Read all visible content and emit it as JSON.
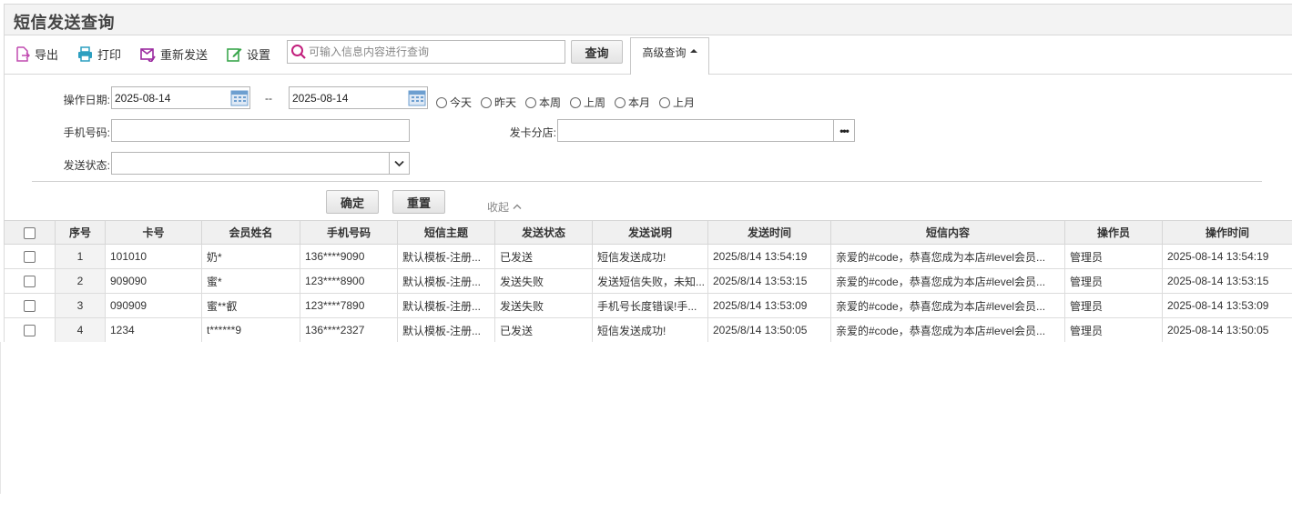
{
  "page": {
    "title": "短信发送查询"
  },
  "toolbar": {
    "export_label": "导出",
    "print_label": "打印",
    "resend_label": "重新发送",
    "settings_label": "设置",
    "search_placeholder": "可输入信息内容进行查询",
    "search_button": "查询",
    "advanced_tab": "高级查询"
  },
  "filters": {
    "date_label": "操作日期:",
    "date_from": "2025-08-14",
    "date_sep": "--",
    "date_to": "2025-08-14",
    "quick_ranges": [
      "今天",
      "昨天",
      "本周",
      "上周",
      "本月",
      "上月"
    ],
    "phone_label": "手机号码:",
    "phone_value": "",
    "branch_label": "发卡分店:",
    "branch_value": "",
    "status_label": "发送状态:",
    "status_value": "",
    "confirm_button": "确定",
    "reset_button": "重置",
    "collapse_label": "收起"
  },
  "table": {
    "columns": [
      "序号",
      "卡号",
      "会员姓名",
      "手机号码",
      "短信主题",
      "发送状态",
      "发送说明",
      "发送时间",
      "短信内容",
      "操作员",
      "操作时间"
    ],
    "rows": [
      [
        "1",
        "101010",
        "奶*",
        "136****9090",
        "默认模板-注册...",
        "已发送",
        "短信发送成功!",
        "2025/8/14 13:54:19",
        "亲爱的#code，恭喜您成为本店#level会员...",
        "管理员",
        "2025-08-14 13:54:19"
      ],
      [
        "2",
        "909090",
        "蜜*",
        "123****8900",
        "默认模板-注册...",
        "发送失败",
        "发送短信失败，未知...",
        "2025/8/14 13:53:15",
        "亲爱的#code，恭喜您成为本店#level会员...",
        "管理员",
        "2025-08-14 13:53:15"
      ],
      [
        "3",
        "090909",
        "蜜**叡",
        "123****7890",
        "默认模板-注册...",
        "发送失败",
        "手机号长度错误!手...",
        "2025/8/14 13:53:09",
        "亲爱的#code，恭喜您成为本店#level会员...",
        "管理员",
        "2025-08-14 13:53:09"
      ],
      [
        "4",
        "1234",
        "t******9",
        "136****2327",
        "默认模板-注册...",
        "已发送",
        "短信发送成功!",
        "2025/8/14 13:50:05",
        "亲爱的#code，恭喜您成为本店#level会员...",
        "管理员",
        "2025-08-14 13:50:05"
      ]
    ]
  },
  "icons": {
    "export": "export-icon",
    "print": "printer-icon",
    "resend": "resend-icon",
    "settings": "edit-settings-icon",
    "search": "search-icon",
    "calendar": "calendar-icon"
  },
  "colors": {
    "export_icon": "#c04bb0",
    "print_icon": "#2c9fc0",
    "resend_icon": "#9b2aa0",
    "settings_icon": "#3aa64c",
    "search_icon": "#c2207d",
    "calendar_icon": "#6d9fd0"
  }
}
